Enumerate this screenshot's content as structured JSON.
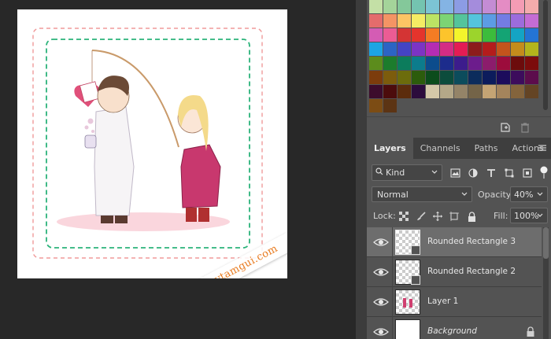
{
  "canvas": {
    "watermark_text": "caytamgui.com"
  },
  "swatches": {
    "colors": [
      "#c4e0a6",
      "#a4d49a",
      "#84c89a",
      "#74c4b0",
      "#7cc4d4",
      "#84b4e4",
      "#8c9ce4",
      "#a48cdc",
      "#c48cd4",
      "#e48cc4",
      "#f49cb4",
      "#f4acac",
      "#e46c6c",
      "#f49464",
      "#fcc464",
      "#f4ec64",
      "#bce464",
      "#7cd474",
      "#54c49c",
      "#54c4dc",
      "#5c9ce4",
      "#747ce4",
      "#9c6cdc",
      "#c46cd4",
      "#d45cb4",
      "#ec5c94",
      "#d43434",
      "#e4342c",
      "#f47c24",
      "#fcc42c",
      "#f4f42c",
      "#9cd42c",
      "#3cbc3c",
      "#14a474",
      "#14a4c4",
      "#2474d4",
      "#1ca4e4",
      "#2c64c4",
      "#4444c4",
      "#7c34c4",
      "#b42cb4",
      "#d42c84",
      "#e41c54",
      "#8c1c1c",
      "#b41c1c",
      "#c4541c",
      "#c48c1c",
      "#b4b41c",
      "#5c8c1c",
      "#1c7c2c",
      "#0c7c5c",
      "#0c7c8c",
      "#0c4c8c",
      "#1c2c8c",
      "#3c1c8c",
      "#6c1c8c",
      "#8c1c6c",
      "#9c0c3c",
      "#6c0c0c",
      "#7c0c0c",
      "#7c3c0c",
      "#7c5c0c",
      "#6c6c0c",
      "#2c5c0c",
      "#0c4c1c",
      "#0c4c3c",
      "#0c4c5c",
      "#0c2c5c",
      "#0c1c5c",
      "#1c0c5c",
      "#3c0c5c",
      "#5c0c4c",
      "#3c0c2c",
      "#4c0c0c",
      "#5c2c0c",
      "#2c0c3c",
      "#d4c8a8",
      "#b4a888",
      "#948468",
      "#746448",
      "#c4a474",
      "#a4845c",
      "#84643c",
      "#644424",
      "#7c4c14",
      "#5c3414"
    ]
  },
  "tabs": [
    {
      "label": "Layers",
      "active": true
    },
    {
      "label": "Channels",
      "active": false
    },
    {
      "label": "Paths",
      "active": false
    },
    {
      "label": "Actions",
      "active": false
    }
  ],
  "filter": {
    "kind_label": "Kind"
  },
  "blend": {
    "mode": "Normal",
    "opacity_label": "Opacity:",
    "opacity_value": "40%",
    "lock_label": "Lock:",
    "fill_label": "Fill:",
    "fill_value": "100%"
  },
  "layers": [
    {
      "name": "Rounded Rectangle 3",
      "selected": true,
      "type": "shape"
    },
    {
      "name": "Rounded Rectangle 2",
      "selected": false,
      "type": "shape"
    },
    {
      "name": "Layer 1",
      "selected": false,
      "type": "raster"
    },
    {
      "name": "Background",
      "selected": false,
      "type": "background"
    }
  ]
}
